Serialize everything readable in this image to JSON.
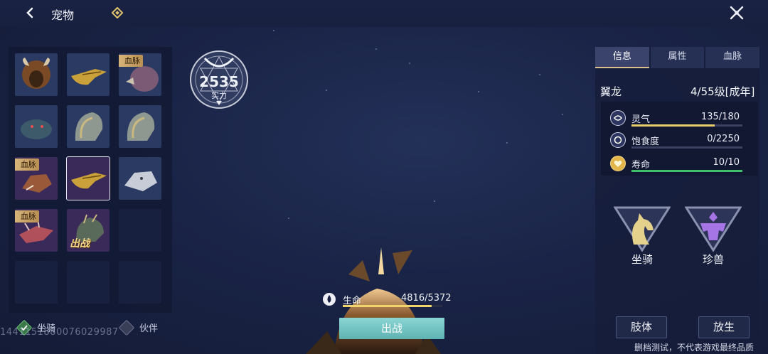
{
  "header": {
    "title": "宠物",
    "back_icon": "chevron-left-icon",
    "close_icon": "crossed-swords-close-icon"
  },
  "pets": [
    {
      "name": "boar",
      "bloodline": false,
      "selected": false,
      "deployed": false
    },
    {
      "name": "golden-crocodile",
      "bloodline": false,
      "selected": false,
      "deployed": false
    },
    {
      "name": "purple-vulture",
      "bloodline": true,
      "tag": "血脉",
      "selected": false,
      "deployed": false
    },
    {
      "name": "blue-lizard",
      "bloodline": false,
      "selected": false,
      "deployed": false
    },
    {
      "name": "grey-serpent",
      "bloodline": false,
      "selected": false,
      "deployed": false
    },
    {
      "name": "grey-serpent-2",
      "bloodline": false,
      "selected": false,
      "deployed": false
    },
    {
      "name": "red-wolf",
      "bloodline": true,
      "tag": "血脉",
      "selected": false,
      "deployed": false
    },
    {
      "name": "golden-crocodile-2",
      "bloodline": false,
      "selected": true,
      "deployed": false
    },
    {
      "name": "white-wolf",
      "bloodline": false,
      "selected": false,
      "deployed": false
    },
    {
      "name": "red-dragon",
      "bloodline": true,
      "tag": "血脉",
      "selected": false,
      "deployed": false
    },
    {
      "name": "wyvern",
      "bloodline": false,
      "selected": false,
      "deployed": true,
      "deploy_tag": "出战"
    }
  ],
  "filters": {
    "mount_label": "坐骑",
    "partner_label": "伙伴"
  },
  "uid": "1441151880076029987",
  "power": {
    "value": "2535",
    "label": "实力"
  },
  "hp": {
    "label": "生命",
    "value": "4816/5372",
    "fraction": 0.896
  },
  "deploy_button": "出战",
  "panel": {
    "tabs": [
      "信息",
      "属性",
      "血脉"
    ],
    "active_tab": 0,
    "pet_name": "翼龙",
    "level": "4/55级[成年]",
    "stats": [
      {
        "icon": "spirit-icon",
        "label": "灵气",
        "value": "135/180",
        "fraction": 0.75,
        "color": "#e5cf6a"
      },
      {
        "icon": "satiety-icon",
        "label": "饱食度",
        "value": "0/2250",
        "fraction": 0.0,
        "color": "#e5cf6a"
      },
      {
        "icon": "heart-icon",
        "label": "寿命",
        "value": "10/10",
        "fraction": 1.0,
        "color": "#3fc06a"
      }
    ],
    "roles": [
      {
        "label": "坐骑",
        "icon": "horse-icon",
        "color": "#e4d28c"
      },
      {
        "label": "珍兽",
        "icon": "rare-beast-icon",
        "color": "#a575e6"
      }
    ],
    "limb_button": "肢体",
    "release_button": "放生"
  },
  "disclaimer": "删档测试，不代表游戏最终品质"
}
